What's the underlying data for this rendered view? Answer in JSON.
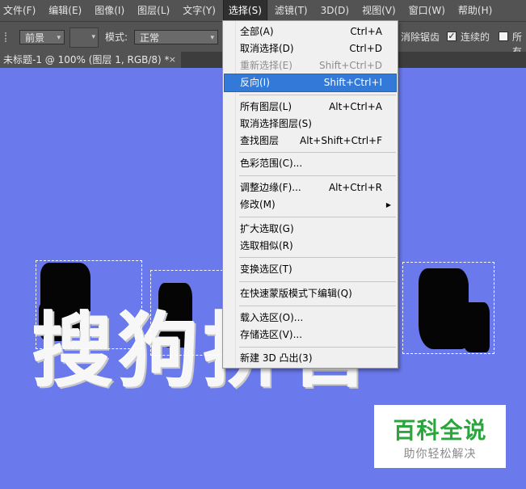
{
  "menubar": {
    "items": [
      "文件(F)",
      "编辑(E)",
      "图像(I)",
      "图层(L)",
      "文字(Y)",
      "选择(S)",
      "滤镜(T)",
      "3D(D)",
      "视图(V)",
      "窗口(W)",
      "帮助(H)"
    ],
    "active_index": 5
  },
  "options": {
    "preset": "前景",
    "mode_label": "模式:",
    "mode_value": "正常",
    "antialias_label": "消除锯齿",
    "contiguous_label": "连续的",
    "all_layers_label": "所有"
  },
  "document": {
    "tab_title": "未标题-1 @ 100% (图层 1, RGB/8) *",
    "close_glyph": "×"
  },
  "canvas": {
    "background": "#6a79ec",
    "art_text": "搜狗拼音"
  },
  "select_menu": {
    "items": [
      {
        "label": "全部(A)",
        "shortcut": "Ctrl+A",
        "state": "normal"
      },
      {
        "label": "取消选择(D)",
        "shortcut": "Ctrl+D",
        "state": "normal"
      },
      {
        "label": "重新选择(E)",
        "shortcut": "Shift+Ctrl+D",
        "state": "disabled"
      },
      {
        "label": "反向(I)",
        "shortcut": "Shift+Ctrl+I",
        "state": "highlighted"
      },
      {
        "label": "所有图层(L)",
        "shortcut": "Alt+Ctrl+A",
        "state": "normal"
      },
      {
        "label": "取消选择图层(S)",
        "shortcut": "",
        "state": "normal"
      },
      {
        "label": "查找图层",
        "shortcut": "Alt+Shift+Ctrl+F",
        "state": "normal"
      },
      {
        "label": "色彩范围(C)...",
        "shortcut": "",
        "state": "normal"
      },
      {
        "label": "调整边缘(F)...",
        "shortcut": "Alt+Ctrl+R",
        "state": "normal"
      },
      {
        "label": "修改(M)",
        "shortcut": "",
        "state": "submenu"
      },
      {
        "label": "扩大选取(G)",
        "shortcut": "",
        "state": "normal"
      },
      {
        "label": "选取相似(R)",
        "shortcut": "",
        "state": "normal"
      },
      {
        "label": "变换选区(T)",
        "shortcut": "",
        "state": "normal"
      },
      {
        "label": "在快速蒙版模式下编辑(Q)",
        "shortcut": "",
        "state": "normal"
      },
      {
        "label": "载入选区(O)...",
        "shortcut": "",
        "state": "normal"
      },
      {
        "label": "存储选区(V)...",
        "shortcut": "",
        "state": "normal"
      },
      {
        "label": "新建 3D 凸出(3)",
        "shortcut": "",
        "state": "normal"
      }
    ],
    "submenu_glyph": "▶"
  },
  "watermark": {
    "title": "百科全说",
    "subtitle": "助你轻松解决"
  },
  "colors": {
    "menubar_bg": "#535353",
    "menu_highlight": "#3379d8",
    "watermark_green": "#2aa63c"
  },
  "icons": {
    "dropdown_arrow": "▾",
    "check_mark": "✓"
  }
}
